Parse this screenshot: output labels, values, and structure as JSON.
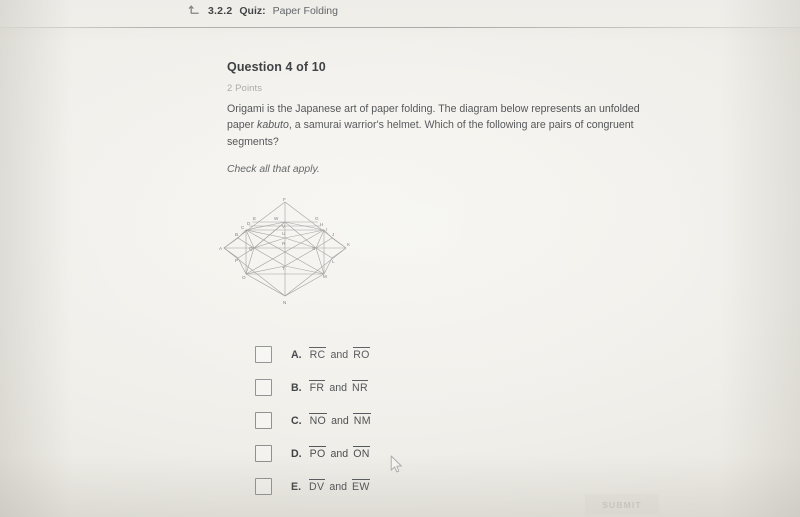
{
  "header": {
    "back_icon": "back-arrow-icon",
    "lesson_number": "3.2.2",
    "section_label": "Quiz:",
    "lesson_title": "Paper Folding"
  },
  "question": {
    "title": "Question 4 of 10",
    "points": "2 Points",
    "body_part1": "Origami is the Japanese art of paper folding. The diagram below represents an unfolded paper ",
    "body_italic": "kabuto",
    "body_part2": ", a samurai warrior's helmet. Which of the following are pairs of congruent segments?",
    "instruction": "Check all that apply."
  },
  "diagram": {
    "name": "origami-kabuto-crease-diagram",
    "vertex_labels": [
      "A",
      "B",
      "C",
      "D",
      "E",
      "F",
      "G",
      "H",
      "I",
      "J",
      "K",
      "L",
      "M",
      "N",
      "O",
      "P",
      "Q",
      "R",
      "S",
      "T",
      "U",
      "V",
      "W"
    ]
  },
  "options": [
    {
      "letter": "A.",
      "seg1": "RC",
      "connector": "and",
      "seg2": "RO",
      "checked": false
    },
    {
      "letter": "B.",
      "seg1": "FR",
      "connector": "and",
      "seg2": "NR",
      "checked": false
    },
    {
      "letter": "C.",
      "seg1": "NO",
      "connector": "and",
      "seg2": "NM",
      "checked": false
    },
    {
      "letter": "D.",
      "seg1": "PO",
      "connector": "and",
      "seg2": "ON",
      "checked": false
    },
    {
      "letter": "E.",
      "seg1": "DV",
      "connector": "and",
      "seg2": "EW",
      "checked": false
    }
  ],
  "footer": {
    "submit_label": "SUBMIT"
  },
  "colors": {
    "page_background": "#f1efea",
    "header_background": "#f5f3ef",
    "text_primary": "#3a3d40",
    "text_secondary": "#4a4d50",
    "text_muted": "#a7a9a6",
    "checkbox_border": "#8e918f",
    "submit_background": "#e7e5de",
    "submit_text": "#cdcbc4"
  }
}
